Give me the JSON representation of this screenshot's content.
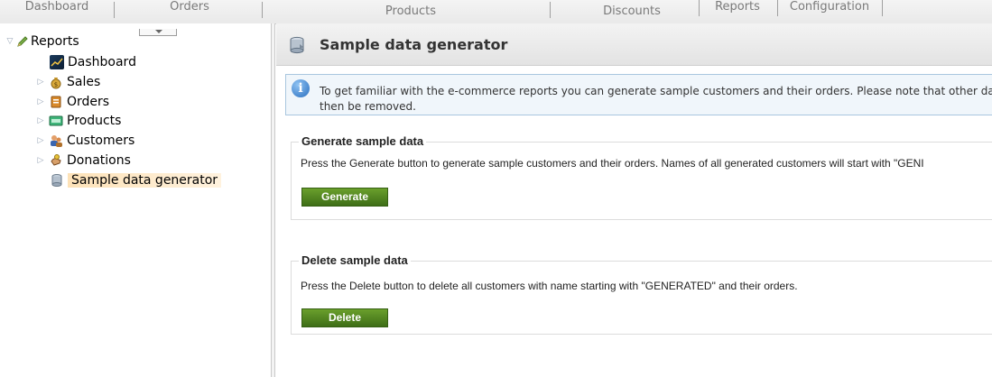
{
  "top_nav": {
    "tabs": [
      {
        "label": "Dashboard"
      },
      {
        "label": "Orders"
      },
      {
        "label": "Products"
      },
      {
        "label": "Discounts"
      },
      {
        "label": "Reports"
      },
      {
        "label": "Configuration"
      }
    ]
  },
  "tree": {
    "root_label": "Reports",
    "items": [
      {
        "label": "Dashboard",
        "icon": "dashboard-icon",
        "expandable": false
      },
      {
        "label": "Sales",
        "icon": "money-bag-icon",
        "expandable": true
      },
      {
        "label": "Orders",
        "icon": "orders-icon",
        "expandable": true
      },
      {
        "label": "Products",
        "icon": "products-icon",
        "expandable": true
      },
      {
        "label": "Customers",
        "icon": "customers-icon",
        "expandable": true
      },
      {
        "label": "Donations",
        "icon": "donations-icon",
        "expandable": true
      },
      {
        "label": "Sample data generator",
        "icon": "database-icon",
        "expandable": false,
        "selected": true
      }
    ]
  },
  "main": {
    "title": "Sample data generator",
    "info_text": "To get familiar with the e-commerce reports you can generate sample customers and their orders. Please note that other da then be removed.",
    "generate": {
      "legend": "Generate sample data",
      "description": "Press the Generate button to generate sample customers and their orders. Names of all generated customers will start with \"GENI",
      "button_label": "Generate"
    },
    "delete": {
      "legend": "Delete sample data",
      "description": "Press the Delete button to delete all customers with name starting with \"GENERATED\" and their orders.",
      "button_label": "Delete"
    }
  },
  "colors": {
    "button_green": "#4f8520",
    "selected_highlight": "#fde2b8",
    "info_border": "#a9c6df"
  }
}
